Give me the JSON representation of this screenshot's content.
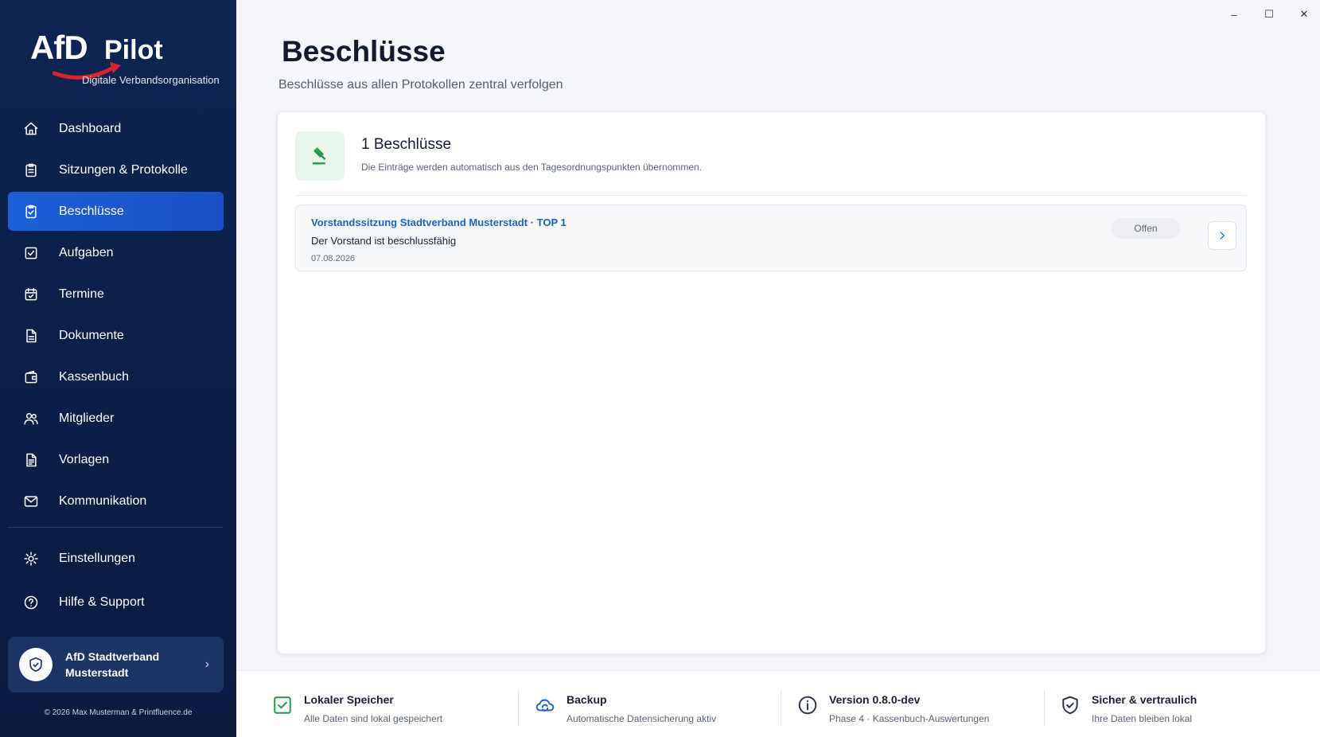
{
  "app": {
    "logo_main": "AfD",
    "logo_pilot": "Pilot",
    "tagline": "Digitale Verbandsorganisation"
  },
  "sidebar": {
    "items": [
      {
        "label": "Dashboard",
        "icon": "home-icon"
      },
      {
        "label": "Sitzungen & Protokolle",
        "icon": "clipboard-icon"
      },
      {
        "label": "Beschlüsse",
        "icon": "checklist-icon",
        "active": true
      },
      {
        "label": "Aufgaben",
        "icon": "checkbox-icon"
      },
      {
        "label": "Termine",
        "icon": "calendar-icon"
      },
      {
        "label": "Dokumente",
        "icon": "document-icon"
      },
      {
        "label": "Kassenbuch",
        "icon": "wallet-icon"
      },
      {
        "label": "Mitglieder",
        "icon": "users-icon"
      },
      {
        "label": "Vorlagen",
        "icon": "template-icon"
      },
      {
        "label": "Kommunikation",
        "icon": "mail-icon"
      }
    ],
    "secondary": [
      {
        "label": "Einstellungen",
        "icon": "gear-icon"
      },
      {
        "label": "Hilfe & Support",
        "icon": "help-icon"
      }
    ],
    "org_name": "AfD Stadtverband Musterstadt",
    "copyright": "© 2026 Max Musterman & Printfluence.de"
  },
  "window": {
    "minimize": "–",
    "maximize": "☐",
    "close": "✕"
  },
  "page": {
    "title": "Beschlüsse",
    "subtitle": "Beschlüsse aus allen Protokollen zentral verfolgen"
  },
  "summary": {
    "count_label": "1 Beschlüsse",
    "description": "Die Einträge werden automatisch aus den Tagesordnungspunkten übernommen."
  },
  "entries": [
    {
      "title": "Vorstandssitzung Stadtverband Musterstadt · TOP 1",
      "text": "Der Vorstand ist beschlussfähig",
      "date": "07.08.2026",
      "status": "Offen"
    }
  ],
  "footer": [
    {
      "title": "Lokaler Speicher",
      "subtitle": "Alle Daten sind lokal gespeichert",
      "icon": "check-square-icon",
      "color": "#1f9a4a"
    },
    {
      "title": "Backup",
      "subtitle": "Automatische Datensicherung aktiv",
      "icon": "cloud-sync-icon",
      "color": "#1a62d4"
    },
    {
      "title": "Version 0.8.0-dev",
      "subtitle": "Phase 4 · Kassenbuch-Auswertungen",
      "icon": "info-icon",
      "color": "#2a3344"
    },
    {
      "title": "Sicher & vertraulich",
      "subtitle": "Ihre Daten bleiben lokal",
      "icon": "shield-check-icon",
      "color": "#2a3344"
    }
  ],
  "colors": {
    "sidebar_bg": "#0d2553",
    "active_bg": "#1a5fd6",
    "link": "#1a62d4",
    "success": "#1f9a4a"
  }
}
